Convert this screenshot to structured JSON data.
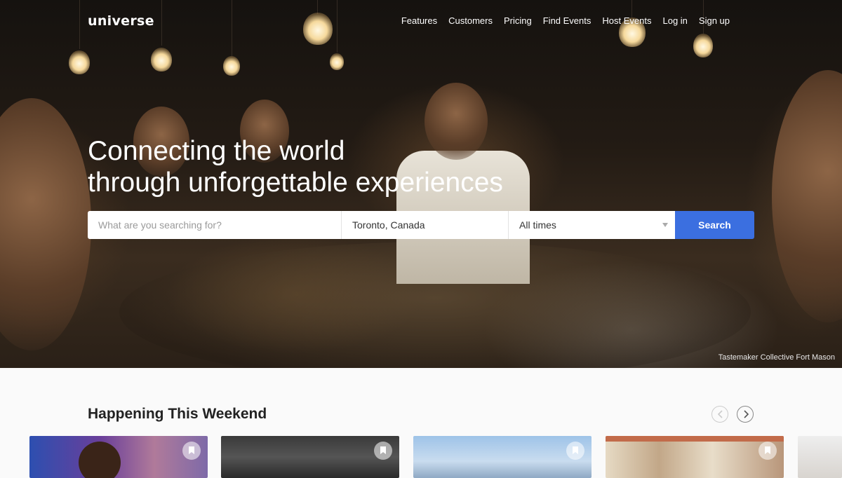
{
  "brand": {
    "logo": "universe"
  },
  "nav": {
    "links": [
      "Features",
      "Customers",
      "Pricing",
      "Find Events",
      "Host Events",
      "Log in",
      "Sign up"
    ]
  },
  "hero": {
    "headline_line1": "Connecting the world",
    "headline_line2": "through unforgettable experiences",
    "photo_credit": "Tastemaker Collective Fort Mason"
  },
  "search": {
    "query_placeholder": "What are you searching for?",
    "location_value": "Toronto, Canada",
    "time_value": "All times",
    "button_label": "Search"
  },
  "weekend": {
    "title": "Happening This Weekend",
    "cards": [
      {
        "icon": "bookmark-icon"
      },
      {
        "icon": "bookmark-icon"
      },
      {
        "icon": "bookmark-icon"
      },
      {
        "icon": "bookmark-icon"
      }
    ]
  },
  "colors": {
    "accent": "#3b6fe0"
  }
}
